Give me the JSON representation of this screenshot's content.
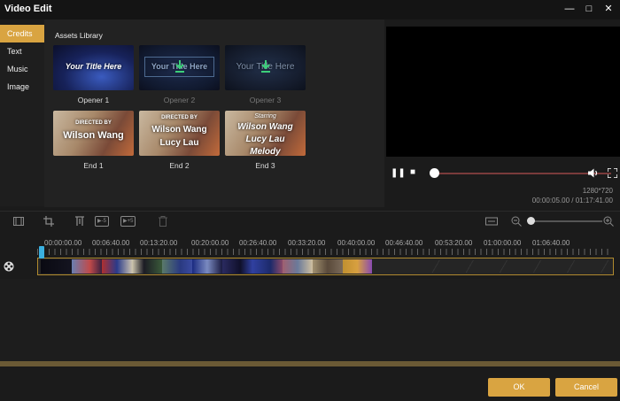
{
  "window": {
    "title": "Video Edit",
    "controls": [
      "minimize-icon",
      "maximize-icon",
      "close-icon"
    ]
  },
  "sidebar": {
    "items": [
      {
        "label": "Credits",
        "active": true
      },
      {
        "label": "Text",
        "active": false
      },
      {
        "label": "Music",
        "active": false
      },
      {
        "label": "Image",
        "active": false
      }
    ]
  },
  "assets": {
    "heading": "Assets Library",
    "tiles": [
      {
        "caption": "Opener 1",
        "overlay": "Your Title Here",
        "downloaded": true
      },
      {
        "caption": "Opener 2",
        "overlay": "Your Title Here",
        "downloaded": false
      },
      {
        "caption": "Opener 3",
        "overlay": "Your Title Here",
        "downloaded": false
      },
      {
        "caption": "End 1",
        "line1": "DIRECTED BY",
        "line2": "Wilson Wang"
      },
      {
        "caption": "End 2",
        "line1": "DIRECTED BY",
        "line2": "Wilson Wang",
        "line3": "Lucy Lau"
      },
      {
        "caption": "End 3",
        "line1": "Starring",
        "line2": "Wilson Wang",
        "line3": "Lucy Lau",
        "line4": "Melody"
      }
    ]
  },
  "player": {
    "resolution": "1280*720",
    "timecode": "00:00:05.00 / 01:17:41.00",
    "progress": 0.001,
    "icons": [
      "pause-icon",
      "stop-icon",
      "volume-icon",
      "fullscreen-icon"
    ]
  },
  "timeline": {
    "ticks": [
      "00:00:00.00",
      "00:06:40.00",
      "00:13:20.00",
      "00:20:00.00",
      "00:26:40.00",
      "00:33:20.00",
      "00:40:00.00",
      "00:46:40.00",
      "00:53:20.00",
      "01:00:00.00",
      "01:06:40.00"
    ],
    "toolbar_icons": [
      "film-icon",
      "crop-icon",
      "split-icon",
      "speed-down-icon",
      "speed-up-icon",
      "delete-icon",
      "fit-icon",
      "zoom-out-icon",
      "zoom-in-icon"
    ],
    "speed_down_label": "▶-5",
    "speed_up_label": "▶+5"
  },
  "footer": {
    "ok_label": "OK",
    "cancel_label": "Cancel"
  },
  "colors": {
    "accent": "#d9a441",
    "playhead": "#3ab0e0",
    "track_border": "#b08a2e"
  }
}
